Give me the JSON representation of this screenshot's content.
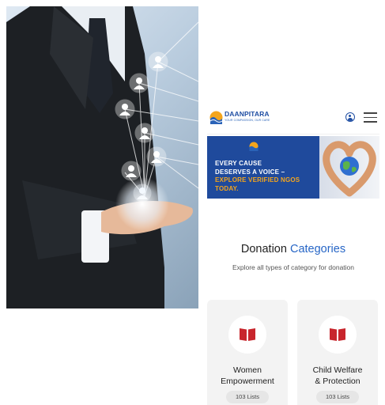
{
  "header": {
    "brand_name": "DAANPITARA",
    "brand_tagline": "YOUR COMPASSION, OUR CARE",
    "profile_icon": "user-circle-icon",
    "menu_icon": "hamburger-menu-icon"
  },
  "banner": {
    "line1": "EVERY CAUSE",
    "line2": "DESERVES A VOICE –",
    "line3": "EXPLORE VERIFIED NGOS",
    "line4": "TODAY."
  },
  "section": {
    "title_main": "Donation",
    "title_highlight": "Categories",
    "subtitle": "Explore all types of category for donation"
  },
  "categories": [
    {
      "title_line1": "Women",
      "title_line2": "Empowerment",
      "badge": "103 Lists",
      "icon": "book-icon"
    },
    {
      "title_line1": "Child Welfare",
      "title_line2": "& Protection",
      "badge": "103 Lists",
      "icon": "book-icon"
    }
  ],
  "colors": {
    "brand_blue": "#1f4ea3",
    "accent_blue": "#2766c6",
    "accent_orange": "#f4a51c",
    "icon_red": "#c8252c"
  }
}
